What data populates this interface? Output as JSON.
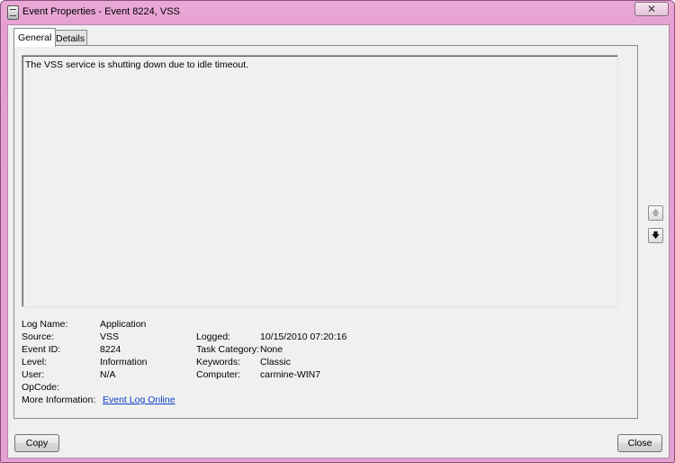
{
  "window": {
    "title": "Event Properties - Event 8224, VSS",
    "close_glyph": "✕"
  },
  "tabs": [
    {
      "label": "General",
      "selected": true
    },
    {
      "label": "Details",
      "selected": false
    }
  ],
  "description": "The VSS service is shutting down due to idle timeout.",
  "fields": {
    "log_name": {
      "label": "Log Name:",
      "value": "Application"
    },
    "source": {
      "label": "Source:",
      "value": "VSS"
    },
    "event_id": {
      "label": "Event ID:",
      "value": "8224"
    },
    "level": {
      "label": "Level:",
      "value": "Information"
    },
    "user": {
      "label": "User:",
      "value": "N/A"
    },
    "opcode": {
      "label": "OpCode:",
      "value": ""
    },
    "more_info": {
      "label": "More Information:",
      "value": "Event Log Online"
    },
    "logged": {
      "label": "Logged:",
      "value": "10/15/2010 07:20:16"
    },
    "task_category": {
      "label": "Task Category:",
      "value": "None"
    },
    "keywords": {
      "label": "Keywords:",
      "value": "Classic"
    },
    "computer": {
      "label": "Computer:",
      "value": "carmine-WIN7"
    }
  },
  "nav": {
    "up_glyph": "🡅",
    "down_glyph": "🡇"
  },
  "buttons": {
    "copy": "Copy",
    "close": "Close"
  }
}
